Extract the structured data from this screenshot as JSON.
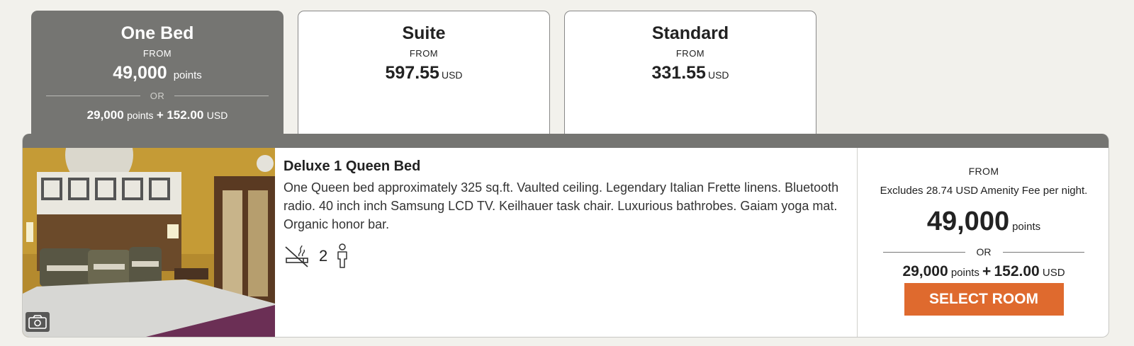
{
  "tabs": [
    {
      "title": "One Bed",
      "from": "FROM",
      "price": "49,000",
      "unit": "points",
      "or": "OR",
      "alt_points": "29,000",
      "alt_points_unit": "points",
      "alt_plus": "+",
      "alt_cash": "152.00",
      "alt_currency": "USD",
      "active": true
    },
    {
      "title": "Suite",
      "from": "FROM",
      "price": "597.55",
      "unit": "USD",
      "active": false
    },
    {
      "title": "Standard",
      "from": "FROM",
      "price": "331.55",
      "unit": "USD",
      "active": false
    }
  ],
  "room": {
    "name": "Deluxe 1 Queen Bed",
    "description": "One Queen bed approximately 325 sq.ft. Vaulted ceiling. Legendary Italian Frette linens. Bluetooth radio. 40 inch inch Samsung LCD TV. Keilhauer task chair. Luxurious bathrobes. Gaiam yoga mat. Organic honor bar.",
    "amenities": {
      "non_smoking_icon": "no-smoking-icon",
      "occupancy": "2",
      "person_icon": "person-icon"
    },
    "photo_icon": "camera-icon"
  },
  "pricing": {
    "from": "FROM",
    "excludes": "Excludes 28.74 USD Amenity Fee per night.",
    "points": "49,000",
    "points_unit": "points",
    "or": "OR",
    "alt_points": "29,000",
    "alt_points_unit": "points",
    "alt_plus": "+",
    "alt_cash": "152.00",
    "alt_currency": "USD",
    "button": "SELECT ROOM"
  },
  "colors": {
    "accent": "#df6a2e",
    "active_tab": "#757572",
    "background": "#f2f1ec"
  }
}
